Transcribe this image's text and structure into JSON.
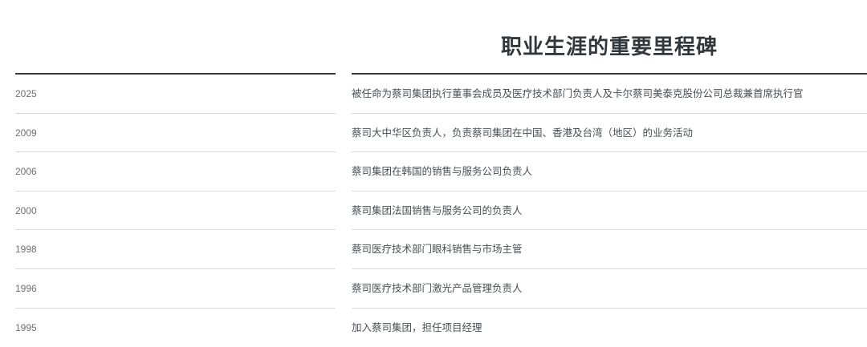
{
  "page": {
    "title": "职业生涯的重要里程碑"
  },
  "milestones": [
    {
      "year": "2025",
      "description": "被任命为蔡司集团执行董事会成员及医疗技术部门负责人及卡尔蔡司美泰克股份公司总裁兼首席执行官"
    },
    {
      "year": "2009",
      "description": "蔡司大中华区负责人，负责蔡司集团在中国、香港及台湾（地区）的业务活动"
    },
    {
      "year": "2006",
      "description": "蔡司集团在韩国的销售与服务公司负责人"
    },
    {
      "year": "2000",
      "description": "蔡司集团法国销售与服务公司的负责人"
    },
    {
      "year": "1998",
      "description": "蔡司医疗技术部门眼科销售与市场主管"
    },
    {
      "year": "1996",
      "description": "蔡司医疗技术部门激光产品管理负责人"
    },
    {
      "year": "1995",
      "description": "加入蔡司集团，担任项目经理"
    }
  ],
  "colors": {
    "title": "#32373c",
    "year_text": "#6b6f75",
    "description_text": "#4a4f55",
    "header_rule": "#3a3a3a",
    "row_separator": "#d9d9d9"
  }
}
